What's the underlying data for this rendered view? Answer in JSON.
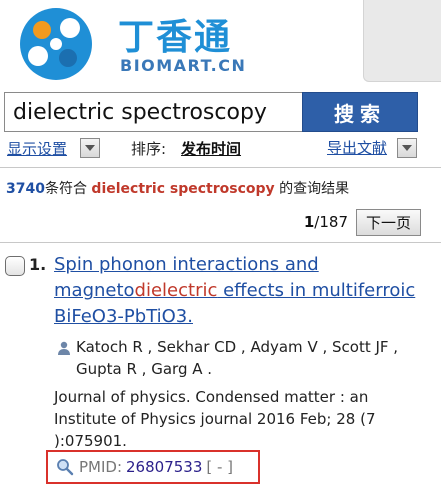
{
  "header": {
    "logo_cn": "丁香通",
    "logo_en": "BIOMART.CN"
  },
  "search": {
    "query": "dielectric spectroscopy",
    "button_label": "搜索"
  },
  "options": {
    "display_settings": "显示设置",
    "sort_label": "排序:",
    "sort_value": "发布时间",
    "export": "导出文献"
  },
  "summary": {
    "count": "3740",
    "prefix": "条符合",
    "term": "dielectric spectroscopy",
    "suffix": "的查询结果"
  },
  "pager": {
    "current": "1",
    "total": "/187",
    "next_label": "下一页"
  },
  "result": {
    "index": "1.",
    "title_part1": "Spin phonon interactions and magneto",
    "title_highlight": "dielectric",
    "title_part2": " effects in multiferroic BiFeO3-PbTiO3.",
    "authors": "Katoch R , Sekhar CD , Adyam V , Scott JF , Gupta R , Garg A .",
    "journal": "Journal of physics. Condensed matter : an Institute of Physics journal 2016 Feb; 28 (7 ):075901.",
    "pmid_label": "PMID:",
    "pmid_value": "26807533",
    "pmid_bracket": "[ - ]"
  },
  "colors": {
    "brand_blue": "#1f8fd6",
    "link_blue": "#1f4fa3",
    "highlight_red": "#c0392b",
    "search_button": "#2e5fa8",
    "annotation_red": "#d9312b"
  }
}
